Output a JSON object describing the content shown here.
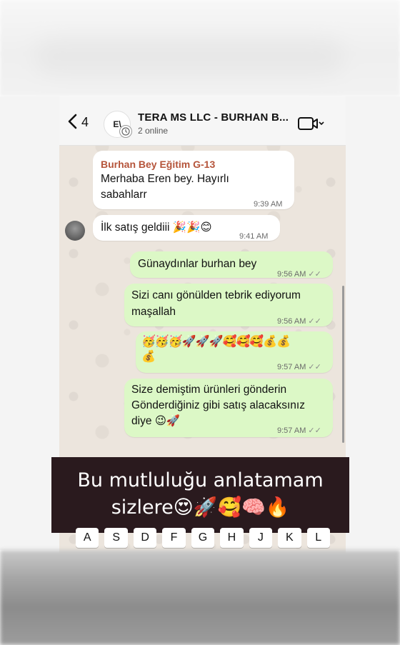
{
  "header": {
    "back_count": "4",
    "avatar_initials": "E\\",
    "title": "TERA MS LLC - BURHAN B...",
    "subtitle": "2 online"
  },
  "messages": [
    {
      "sender": "Burhan Bey Eğitim G-13",
      "text_line1": "Merhaba Eren bey. Hayırlı",
      "text_line2": "sabahlarr",
      "time": "9:39 AM"
    },
    {
      "text": "İlk satış geldiii 🎉🎉😊",
      "time": "9:41 AM"
    },
    {
      "text": "Günaydınlar burhan bey",
      "time": "9:56 AM"
    },
    {
      "text_line1": "Sizi canı gönülden tebrik ediyorum",
      "text_line2": "maşallah",
      "time": "9:56 AM"
    },
    {
      "text_line1": "🥳🥳🥳🚀🚀🚀🥰🥰🥰💰💰",
      "text_line2": "💰",
      "time": "9:57 AM"
    },
    {
      "text_line1": "Size demiştim ürünleri gönderin",
      "text_line2": "Gönderdiğiniz gibi satış alacaksınız",
      "text_line3": "diye 😉🚀",
      "time": "9:57 AM"
    }
  ],
  "caption": {
    "line1": "Bu mutluluğu anlatamam",
    "line2": "sizlere😍🚀🥰🧠🔥"
  },
  "keyboard": [
    "A",
    "S",
    "D",
    "F",
    "G",
    "H",
    "J",
    "K",
    "L"
  ],
  "colors": {
    "incoming": "#ffffff",
    "outgoing": "#dcf8c6",
    "sender_name": "#b5543a",
    "caption_bg": "#2a1a1e"
  }
}
